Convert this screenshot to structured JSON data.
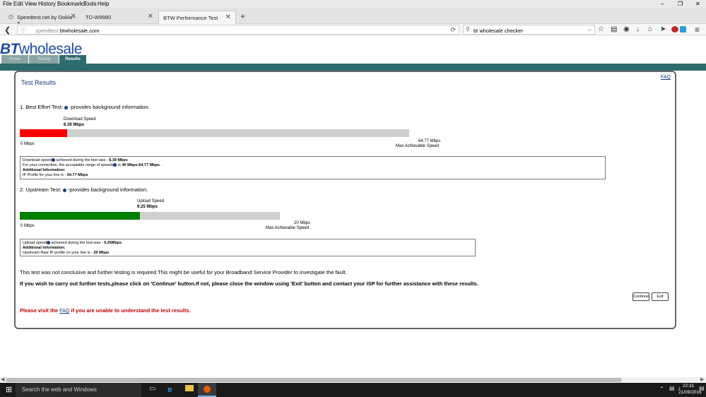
{
  "menu": [
    "File",
    "Edit",
    "View",
    "History",
    "Bookmarks",
    "Tools",
    "Help"
  ],
  "tabs": [
    {
      "label": "Speedtest.net by Ookla - T..."
    },
    {
      "label": "TD-W9980"
    },
    {
      "label": "BTW Performance Test"
    }
  ],
  "url": {
    "host_prefix": "speedtest.",
    "host_domain": "btwholesale.com"
  },
  "search": {
    "value": "bt wholesale checker"
  },
  "brand": {
    "logo_bt": "BT",
    "logo_rest": "wholesale",
    "teal": "#2e6b6c",
    "blue": "#1d4aa3"
  },
  "site_nav": [
    "Home",
    "Testing",
    "Results"
  ],
  "faq_link": "FAQ",
  "results": {
    "title": "Test Results",
    "best_effort": {
      "heading": "1. Best Effort Test:",
      "suffix": " -provides background information.",
      "bar_label": "Download Speed",
      "bar_value": "8.39 Mbps",
      "fill_fraction": 0.1207,
      "fill_color": "#ff0000",
      "min_label": "0 Mbps",
      "max_value": "64.77 Mbps",
      "max_label": "Max Achievable Speed",
      "info": {
        "line1_pre": "Download speed",
        "line1_mid": " achieved during the test was - ",
        "line1_val": "8.39 Mbps",
        "line2_pre": "For your connection, the acceptable range of speeds",
        "line2_mid": " is ",
        "line2_val": "40 Mbps-64.77 Mbps",
        "line2_end": " .",
        "line3": "Additional Information:",
        "line4_pre": "IP Profile for your line is - ",
        "line4_val": "64.77 Mbps"
      }
    },
    "upstream": {
      "heading": "2. Upstream Test:",
      "suffix": " -provides background information.",
      "bar_label": "Upload Speed",
      "bar_value": "9.25 Mbps",
      "fill_fraction": 0.4625,
      "fill_color": "#008000",
      "min_label": "0 Mbps",
      "max_value": "20 Mbps",
      "max_label": "Max Achievable Speed",
      "info": {
        "line1_pre": "Upload speed",
        "line1_mid": " achieved during the test was - ",
        "line1_val": "9.25Mbps",
        "line2": "Additional Information:",
        "line3_pre": "Upstream Rate IP profile on your line is - ",
        "line3_val": "20 Mbps"
      }
    },
    "conclusion": "This test was not conclusive and further testing is required.This might be useful for your Broadband Service Provider to investigate the fault.",
    "instruction": "If you wish to carry out further tests,please click on 'Continue' button.If not, please close the window using 'Exit' button and contact your ISP for further assistance with these results.",
    "continue_label": "Continue",
    "exit_label": "Exit",
    "visit_pre": "Please visit the ",
    "visit_link": "FAQ",
    "visit_post": " if you are unable to understand the test results."
  },
  "taskbar": {
    "search_placeholder": "Search the web and Windows",
    "time": "22:31",
    "date": "21/09/2016"
  }
}
